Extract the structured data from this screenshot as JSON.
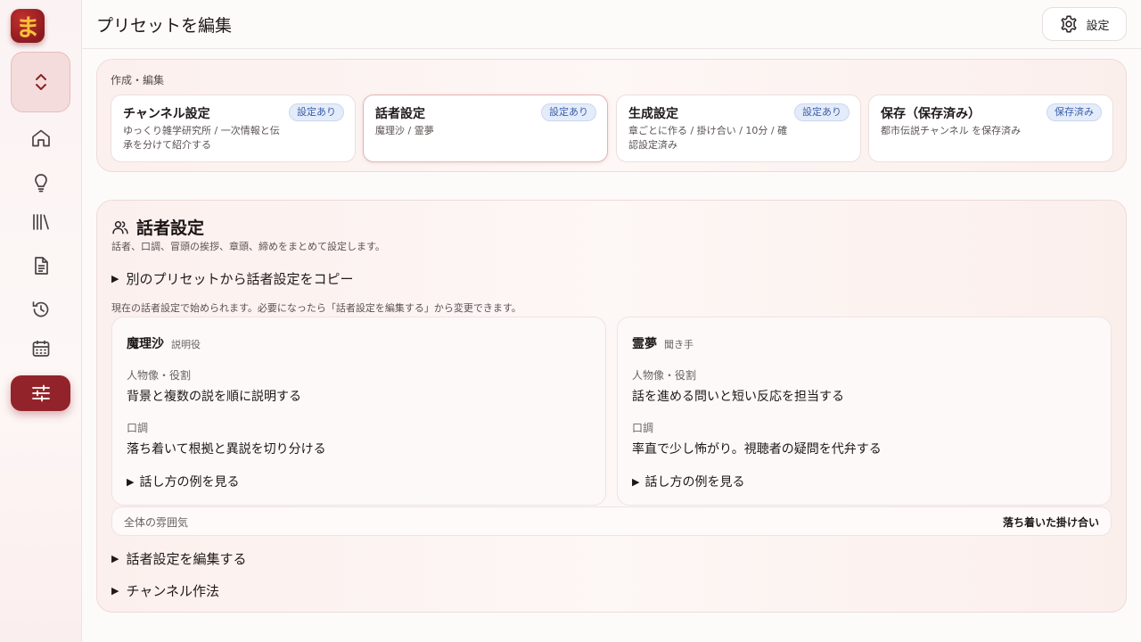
{
  "app": {
    "logo_text": "ま",
    "accent": "#93232a"
  },
  "sidebar": {
    "items": [
      {
        "icon": "home-icon"
      },
      {
        "icon": "lightbulb-icon"
      },
      {
        "icon": "library-icon"
      },
      {
        "icon": "document-icon"
      },
      {
        "icon": "history-icon"
      },
      {
        "icon": "calendar-icon"
      },
      {
        "icon": "sliders-icon",
        "active": true
      }
    ]
  },
  "header": {
    "title": "プリセットを編集",
    "settings_label": "設定"
  },
  "steps": {
    "label": "作成・編集",
    "items": [
      {
        "title": "チャンネル設定",
        "badge": "設定あり",
        "desc": "ゆっくり雑学研究所 / 一次情報と伝承を分けて紹介する"
      },
      {
        "title": "話者設定",
        "badge": "設定あり",
        "desc": "魔理沙 / 霊夢"
      },
      {
        "title": "生成設定",
        "badge": "設定あり",
        "desc": "章ごとに作る / 掛け合い / 10分 / 確認設定済み"
      },
      {
        "title": "保存（保存済み）",
        "badge": "保存済み",
        "desc": "都市伝説チャンネル を保存済み"
      }
    ]
  },
  "speaker_section": {
    "title": "話者設定",
    "subtitle": "話者、口調、冒頭の挨拶、章頭、締めをまとめて設定します。",
    "copy_toggle": "別のプリセットから話者設定をコピー",
    "note": "現在の話者設定で始められます。必要になったら「話者設定を編集する」から変更できます。",
    "speakers": [
      {
        "name": "魔理沙",
        "role": "説明役",
        "persona_label": "人物像・役割",
        "persona": "背景と複数の説を順に説明する",
        "tone_label": "口調",
        "tone": "落ち着いて根拠と異説を切り分ける",
        "example_toggle": "話し方の例を見る"
      },
      {
        "name": "霊夢",
        "role": "聞き手",
        "persona_label": "人物像・役割",
        "persona": "話を進める問いと短い反応を担当する",
        "tone_label": "口調",
        "tone": "率直で少し怖がり。視聴者の疑問を代弁する",
        "example_toggle": "話し方の例を見る"
      }
    ],
    "mood_label": "全体の雰囲気",
    "mood_value": "落ち着いた掛け合い",
    "edit_toggle": "話者設定を編集する",
    "manners_toggle": "チャンネル作法"
  }
}
